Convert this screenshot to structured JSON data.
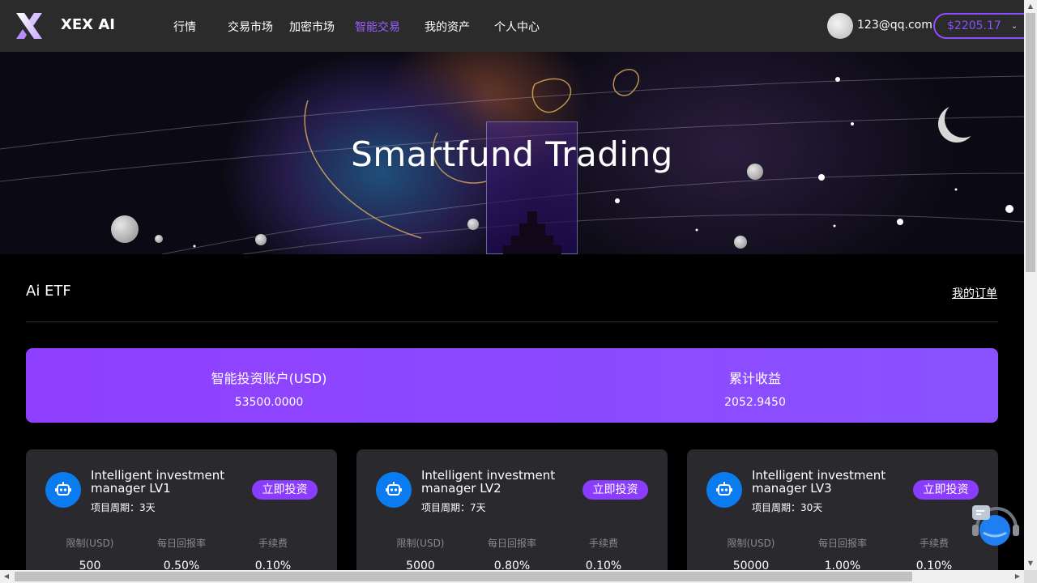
{
  "brand": {
    "name": "XEX AI"
  },
  "nav": [
    {
      "label": "行情",
      "active": false
    },
    {
      "label": "交易市场",
      "active": false
    },
    {
      "label": "加密市场",
      "active": false
    },
    {
      "label": "智能交易",
      "active": true
    },
    {
      "label": "我的资产",
      "active": false
    },
    {
      "label": "个人中心",
      "active": false
    }
  ],
  "user": {
    "email": "123@qq.com",
    "balance": "$2205.17"
  },
  "hero": {
    "title": "Smartfund Trading"
  },
  "section": {
    "title": "Ai ETF",
    "orders_link": "我的订单"
  },
  "account": {
    "investment_label": "智能投资账户(USD)",
    "investment_value": "53500.0000",
    "earnings_label": "累计收益",
    "earnings_value": "2052.9450"
  },
  "cards": [
    {
      "title": "Intelligent investment manager LV1",
      "period": "项目周期：3天",
      "button": "立即投资",
      "stats": [
        {
          "label": "限制(USD)",
          "value": "500"
        },
        {
          "label": "每日回报率",
          "value": "0.50%"
        },
        {
          "label": "手续费",
          "value": "0.10%"
        }
      ]
    },
    {
      "title": "Intelligent investment manager LV2",
      "period": "项目周期：7天",
      "button": "立即投资",
      "stats": [
        {
          "label": "限制(USD)",
          "value": "5000"
        },
        {
          "label": "每日回报率",
          "value": "0.80%"
        },
        {
          "label": "手续费",
          "value": "0.10%"
        }
      ]
    },
    {
      "title": "Intelligent investment manager LV3",
      "period": "项目周期：30天",
      "button": "立即投资",
      "stats": [
        {
          "label": "限制(USD)",
          "value": "50000"
        },
        {
          "label": "每日回报率",
          "value": "1.00%"
        },
        {
          "label": "手续费",
          "value": "0.10%"
        }
      ]
    }
  ],
  "colors": {
    "accent": "#8a3dff",
    "header_bg": "#2b2b2b",
    "card_bg": "#2a2a2e",
    "bot_blue": "#0b7cf0"
  },
  "icons": {
    "logo": "x-logo-icon",
    "bot": "robot-icon",
    "chevron": "chevron-down-icon",
    "support": "customer-service-icon"
  }
}
